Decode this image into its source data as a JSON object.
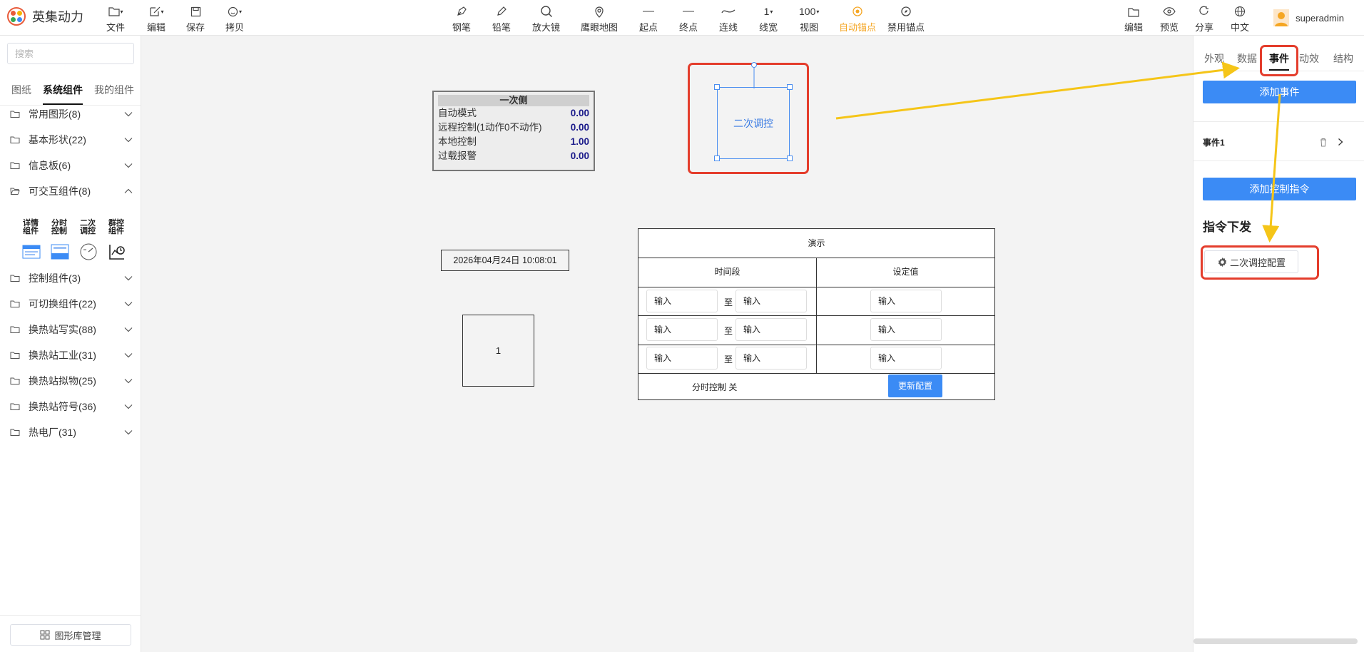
{
  "app": {
    "title": "英集动力"
  },
  "toolbar": {
    "file": "文件",
    "edit": "编辑",
    "save": "保存",
    "copy": "拷贝",
    "pen": "钢笔",
    "pencil": "铅笔",
    "magnifier": "放大镜",
    "eagle_map": "鹰眼地图",
    "start_point": "起点",
    "end_point": "终点",
    "connector": "连线",
    "line_width": "线宽",
    "line_width_value": "1",
    "view": "视图",
    "zoom_value": "100",
    "auto_anchor": "自动锚点",
    "disable_anchor": "禁用锚点",
    "edit2": "编辑",
    "preview": "预览",
    "share": "分享",
    "language": "中文"
  },
  "user": {
    "name": "superadmin"
  },
  "left": {
    "search_placeholder": "搜索",
    "tabs": [
      "图纸",
      "系统组件",
      "我的组件"
    ],
    "categories": [
      "常用图形(8)",
      "基本形状(22)",
      "信息板(6)",
      "可交互组件(8)",
      "控制组件(3)",
      "可切换组件(22)",
      "换热站写实(88)",
      "换热站工业(31)",
      "换热站拟物(25)",
      "换热站符号(36)",
      "热电厂(31)"
    ],
    "components": [
      {
        "line1": "详情",
        "line2": "组件"
      },
      {
        "line1": "分时",
        "line2": "控制"
      },
      {
        "line1": "二次",
        "line2": "调控"
      },
      {
        "line1": "群控",
        "line2": "组件"
      }
    ],
    "library_button": "图形库管理"
  },
  "canvas": {
    "panel": {
      "title": "一次侧",
      "rows": [
        {
          "label": "自动模式",
          "value": "0.00"
        },
        {
          "label": "远程控制(1动作0不动作)",
          "value": "0.00"
        },
        {
          "label": "本地控制",
          "value": "1.00"
        },
        {
          "label": "过载报警",
          "value": "0.00"
        }
      ]
    },
    "selected_label": "二次调控",
    "datetime": "2026年04月24日 10:08:01",
    "box_label": "1",
    "demo": {
      "title": "演示",
      "col1": "时间段",
      "col2": "设定值",
      "input_placeholder": "输入",
      "to": "至",
      "status": "分时控制 关",
      "update_button": "更新配置"
    }
  },
  "right": {
    "tabs": [
      "外观",
      "数据",
      "事件",
      "动效",
      "结构"
    ],
    "add_event": "添加事件",
    "event_name": "事件1",
    "add_command": "添加控制指令",
    "section_title": "指令下发",
    "config_button": "二次调控配置"
  },
  "colors": {
    "accent": "#3b8bf5",
    "highlight": "#e43d2c",
    "arrow": "#f5c518",
    "active": "#f5a623"
  }
}
